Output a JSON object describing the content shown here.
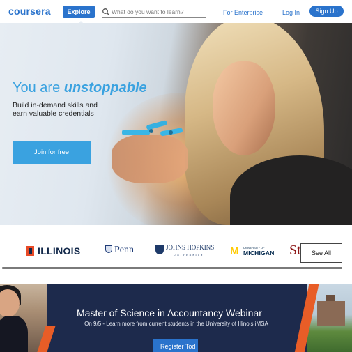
{
  "header": {
    "logo": "coursera",
    "explore_label": "Explore",
    "search_placeholder": "What do you want to learn?",
    "enterprise_label": "For Enterprise",
    "login_label": "Log In",
    "signup_label": "Sign Up"
  },
  "hero": {
    "title_plain": "You are",
    "title_emphasis": "unstoppable",
    "subtitle": "Build in-demand skills and earn valuable credentials",
    "cta_label": "Join for free"
  },
  "partners": {
    "logos": {
      "illinois": "ILLINOIS",
      "penn": "Penn",
      "jhu": "JOHNS HOPKINS",
      "jhu_sub": "UNIVERSITY",
      "michigan_small": "UNIVERSITY OF",
      "michigan_big": "MICHIGAN",
      "stanford": "St"
    },
    "see_all_label": "See All"
  },
  "banner": {
    "title": "Master of Science in Accountancy Webinar",
    "subtitle": "On 9/5 - Learn more from current students in the University of Illinois iMSA",
    "button_label": "Register Tod"
  },
  "colors": {
    "brand_blue": "#2a73cc",
    "hero_blue": "#3aa2e0",
    "banner_navy": "#1d2a4c",
    "accent_orange": "#e85d27"
  }
}
